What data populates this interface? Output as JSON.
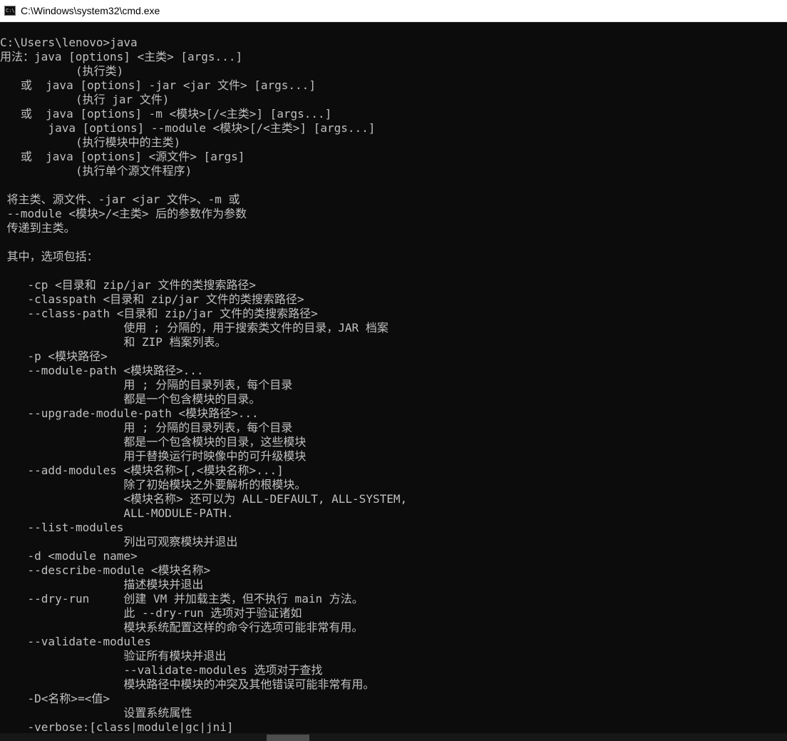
{
  "window": {
    "title": "C:\\Windows\\system32\\cmd.exe",
    "icon": "cmd-icon",
    "icon_text": "C:\\."
  },
  "console_lines": [
    "C:\\Users\\lenovo>java",
    "用法：java [options] <主类> [args...]",
    "           (执行类)",
    "   或  java [options] -jar <jar 文件> [args...]",
    "           (执行 jar 文件)",
    "   或  java [options] -m <模块>[/<主类>] [args...]",
    "       java [options] --module <模块>[/<主类>] [args...]",
    "           (执行模块中的主类)",
    "   或  java [options] <源文件> [args]",
    "           (执行单个源文件程序)",
    "",
    " 将主类、源文件、-jar <jar 文件>、-m 或",
    " --module <模块>/<主类> 后的参数作为参数",
    " 传递到主类。",
    "",
    " 其中，选项包括：",
    "",
    "    -cp <目录和 zip/jar 文件的类搜索路径>",
    "    -classpath <目录和 zip/jar 文件的类搜索路径>",
    "    --class-path <目录和 zip/jar 文件的类搜索路径>",
    "                  使用 ; 分隔的，用于搜索类文件的目录，JAR 档案",
    "                  和 ZIP 档案列表。",
    "    -p <模块路径>",
    "    --module-path <模块路径>...",
    "                  用 ; 分隔的目录列表，每个目录",
    "                  都是一个包含模块的目录。",
    "    --upgrade-module-path <模块路径>...",
    "                  用 ; 分隔的目录列表，每个目录",
    "                  都是一个包含模块的目录，这些模块",
    "                  用于替换运行时映像中的可升级模块",
    "    --add-modules <模块名称>[,<模块名称>...]",
    "                  除了初始模块之外要解析的根模块。",
    "                  <模块名称> 还可以为 ALL-DEFAULT, ALL-SYSTEM,",
    "                  ALL-MODULE-PATH.",
    "    --list-modules",
    "                  列出可观察模块并退出",
    "    -d <module name>",
    "    --describe-module <模块名称>",
    "                  描述模块并退出",
    "    --dry-run     创建 VM 并加载主类，但不执行 main 方法。",
    "                  此 --dry-run 选项对于验证诸如",
    "                  模块系统配置这样的命令行选项可能非常有用。",
    "    --validate-modules",
    "                  验证所有模块并退出",
    "                  --validate-modules 选项对于查找",
    "                  模块路径中模块的冲突及其他错误可能非常有用。",
    "    -D<名称>=<值>",
    "                  设置系统属性",
    "    -verbose:[class|module|gc|jni]"
  ],
  "colors": {
    "background": "#0c0c0c",
    "foreground": "#c0c0c0",
    "titlebar": "#ffffff"
  }
}
